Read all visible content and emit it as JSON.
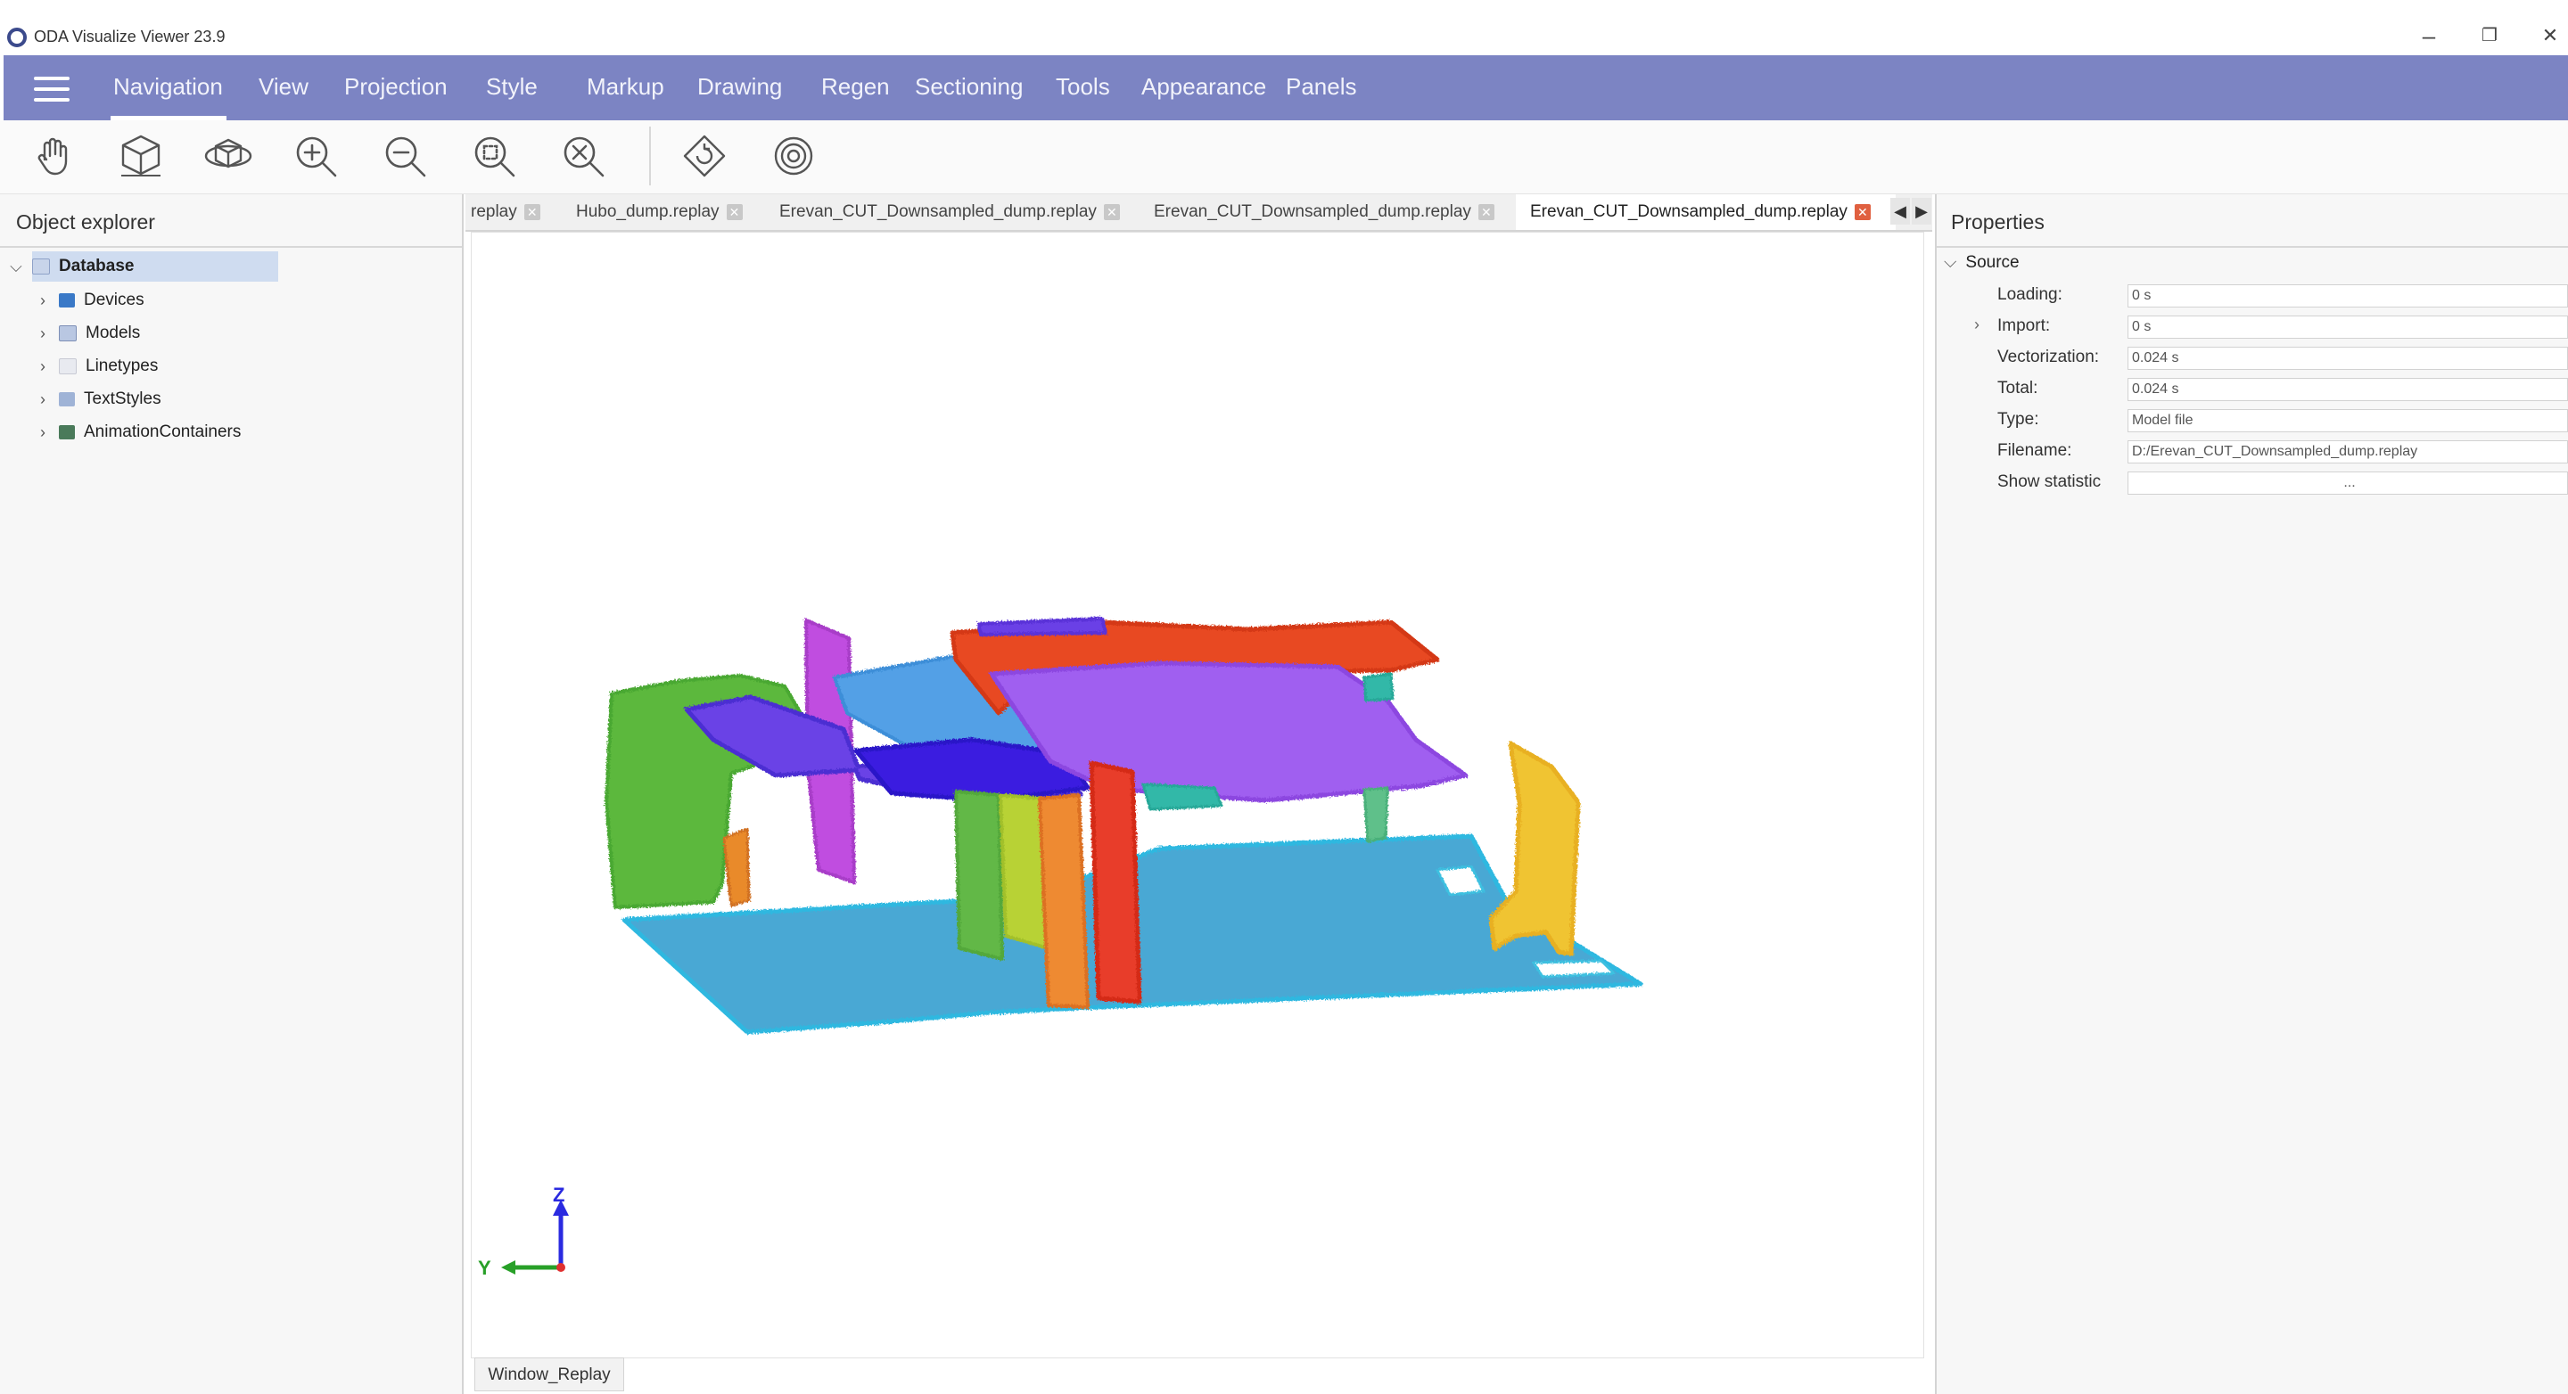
{
  "app": {
    "title": "ODA Visualize Viewer 23.9"
  },
  "window_controls": {
    "minimize": "–",
    "restore": "❐",
    "close": "✕"
  },
  "menu": {
    "items": [
      "Navigation",
      "View",
      "Projection",
      "Style",
      "Markup",
      "Drawing",
      "Regen",
      "Sectioning",
      "Tools",
      "Appearance",
      "Panels"
    ],
    "active": "Navigation"
  },
  "toolbar": {
    "tools": [
      "pan-icon",
      "view-cube-icon",
      "orbit-icon",
      "zoom-in-icon",
      "zoom-out-icon",
      "zoom-window-icon",
      "zoom-extents-icon",
      "rotate-view-icon",
      "walk-icon"
    ]
  },
  "explorer": {
    "title": "Object explorer",
    "root": "Database",
    "children": [
      "Devices",
      "Models",
      "Linetypes",
      "TextStyles",
      "AnimationContainers"
    ]
  },
  "tabs": [
    {
      "label": "replay",
      "active": false
    },
    {
      "label": "Hubo_dump.replay",
      "active": false
    },
    {
      "label": "Erevan_CUT_Downsampled_dump.replay",
      "active": false
    },
    {
      "label": "Erevan_CUT_Downsampled_dump.replay",
      "active": false
    },
    {
      "label": "Erevan_CUT_Downsampled_dump.replay",
      "active": true
    }
  ],
  "tab_close_glyph": "✕",
  "tab_nav": {
    "left": "◀",
    "right": "▶"
  },
  "viewport": {
    "axis_z": "Z",
    "axis_y": "Y",
    "bottom_tab": "Window_Replay"
  },
  "properties": {
    "title": "Properties",
    "section": "Source",
    "rows": [
      {
        "label": "Loading:",
        "value": "0 s"
      },
      {
        "label": "Import:",
        "value": "0 s"
      },
      {
        "label": "Vectorization:",
        "value": "0.024 s"
      },
      {
        "label": "Total:",
        "value": "0.024 s"
      },
      {
        "label": "Type:",
        "value": "Model file"
      },
      {
        "label": "Filename:",
        "value": "D:/Erevan_CUT_Downsampled_dump.replay"
      },
      {
        "label": "Show statistic",
        "value": "..."
      }
    ]
  },
  "colors": {
    "menubar": "#7c84c3",
    "active_tab_close": "#e06040",
    "highlight": "#cfdcf0"
  }
}
